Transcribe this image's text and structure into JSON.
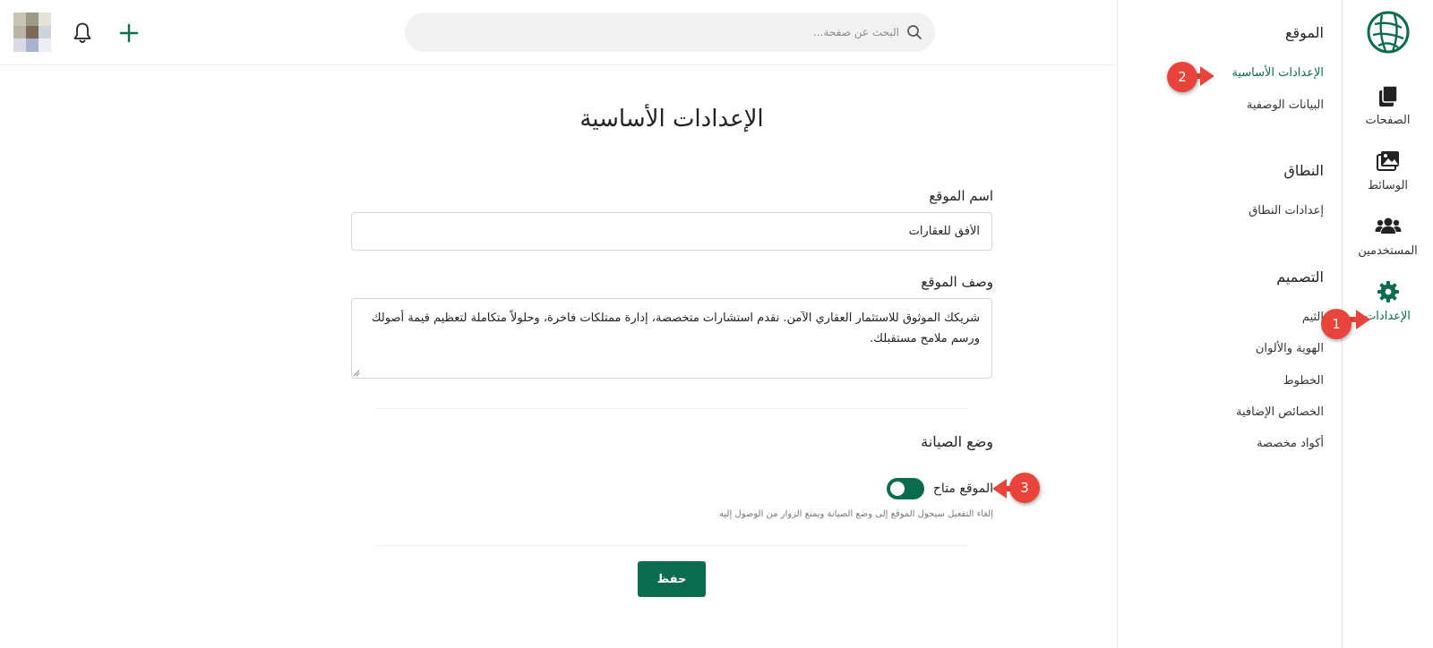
{
  "app": {
    "accent_color": "#0b6b4e",
    "annotation_color": "#e9443b"
  },
  "topbar": {
    "search_placeholder": "البحث عن صفحة...",
    "search_icon": "search-icon",
    "bell_icon": "bell-icon",
    "plus_icon": "plus-icon"
  },
  "rail": {
    "logo_icon": "globe-leaf-logo",
    "items": [
      {
        "label": "الصفحات",
        "icon": "pages-icon"
      },
      {
        "label": "الوسائط",
        "icon": "images-icon"
      },
      {
        "label": "المستخدمين",
        "icon": "users-icon"
      },
      {
        "label": "الإعدادات",
        "icon": "gear-icon",
        "active": true
      }
    ]
  },
  "subnav": {
    "sections": [
      {
        "heading": "الموقع",
        "links": [
          "الإعدادات الأساسية",
          "البيانات الوصفية"
        ]
      },
      {
        "heading": "النطاق",
        "links": [
          "إعدادات النطاق"
        ]
      },
      {
        "heading": "التصميم",
        "links": [
          "الثيم",
          "الهوية والألوان",
          "الخطوط",
          "الخصائص الإضافية",
          "أكواد مخصصة"
        ]
      }
    ],
    "active_link": "الإعدادات الأساسية"
  },
  "main": {
    "title": "الإعدادات الأساسية",
    "site_name_label": "اسم الموقع",
    "site_name_value": "الأفق للعقارات",
    "site_desc_label": "وصف الموقع",
    "site_desc_value": "شريكك الموثوق للاستثمار العقاري الآمن. نقدم استشارات متخصصة، إدارة ممتلكات فاخرة، وحلولاً متكاملة لتعظيم قيمة أصولك ورسم ملامح مستقبلك.",
    "maintenance_heading": "وضع الصيانة",
    "toggle_label": "الموقع متاح",
    "toggle_on": true,
    "help_text": "إلغاء التفعيل سيحول الموقع إلى وضع الصيانة ويمنع الزوار من الوصول إليه",
    "save_label": "حفظ"
  },
  "annotations": [
    "1",
    "2",
    "3"
  ]
}
